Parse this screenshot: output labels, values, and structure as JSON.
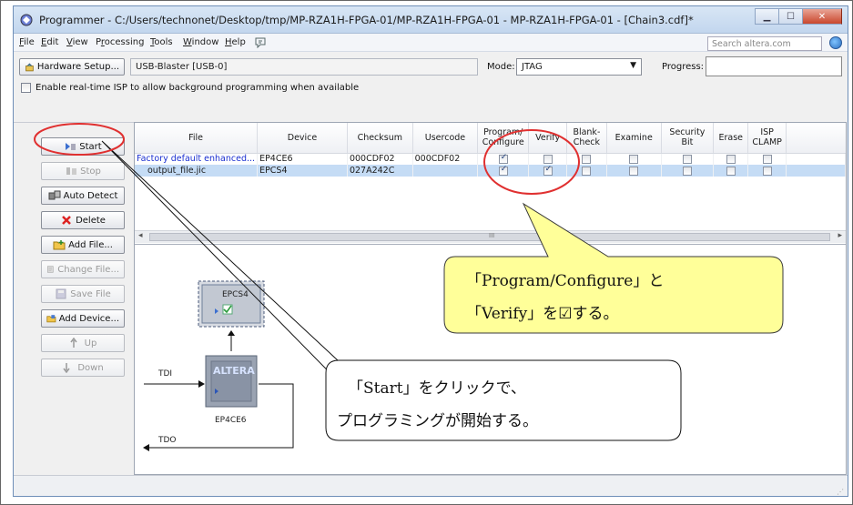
{
  "window": {
    "title": "Programmer - C:/Users/technonet/Desktop/tmp/MP-RZA1H-FPGA-01/MP-RZA1H-FPGA-01 - MP-RZA1H-FPGA-01 - [Chain3.cdf]*",
    "controls": [
      "minimize",
      "maximize",
      "close"
    ]
  },
  "menu": {
    "items": [
      {
        "accel": "F",
        "rest": "ile"
      },
      {
        "accel": "E",
        "rest": "dit"
      },
      {
        "accel": "V",
        "rest": "iew"
      },
      {
        "pre": "P",
        "accel": "r",
        "rest": "ocessing"
      },
      {
        "accel": "T",
        "rest": "ools"
      },
      {
        "accel": "W",
        "rest": "indow"
      },
      {
        "accel": "H",
        "rest": "elp"
      }
    ],
    "search_placeholder": "Search altera.com"
  },
  "toolbar": {
    "hardware_setup_label": "Hardware Setup...",
    "hardware_value": "USB-Blaster [USB-0]",
    "mode_label": "Mode:",
    "mode_value": "JTAG",
    "progress_label": "Progress:",
    "isp_checkbox_label": "Enable real-time ISP to allow background programming when available"
  },
  "left_buttons": {
    "start": "Start",
    "stop": "Stop",
    "auto_detect": "Auto Detect",
    "delete": "Delete",
    "add_file": "Add File...",
    "change_file": "Change File...",
    "save_file": "Save File",
    "add_device": "Add Device...",
    "up": "Up",
    "down": "Down"
  },
  "table": {
    "columns": [
      "File",
      "Device",
      "Checksum",
      "Usercode",
      "Program/ Configure",
      "Verify",
      "Blank- Check",
      "Examine",
      "Security Bit",
      "Erase",
      "ISP CLAMP"
    ],
    "rows": [
      {
        "file": "Factory default enhanced...",
        "device": "EP4CE6",
        "checksum": "000CDF02",
        "usercode": "000CDF02",
        "program": true,
        "verify": false,
        "blank": false,
        "examine": false,
        "security": false,
        "erase": false,
        "isp": false
      },
      {
        "file": "output_file.jic",
        "device": "EPCS4",
        "checksum": "027A242C",
        "usercode": "",
        "program": true,
        "verify": true,
        "blank": false,
        "examine": false,
        "security": false,
        "erase": false,
        "isp": false
      }
    ],
    "scroll_marker": "III"
  },
  "diagram": {
    "chip_top_label": "EPCS4",
    "chip_bottom_label": "EP4CE6",
    "chip_logo": "ALTERA",
    "tdi_label": "TDI",
    "tdo_label": "TDO"
  },
  "callouts": {
    "program_verify_line1": "「Program/Configure」と",
    "program_verify_line2": "「Verify」を☑する。",
    "start_line1": "「Start」をクリックで、",
    "start_line2": "プログラミングが開始する。"
  },
  "colors": {
    "highlight_circle": "#e03030",
    "callout_yellow": "#ffff99",
    "selected_row": "#c5dcf5",
    "first_row_text": "#1a2fd0"
  }
}
